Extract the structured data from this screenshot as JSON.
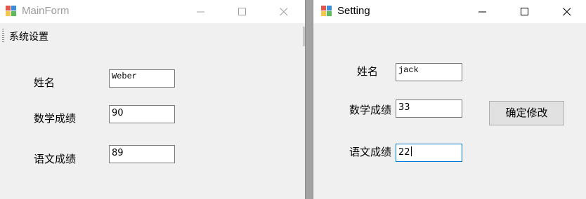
{
  "main_form": {
    "title": "MainForm",
    "menu": {
      "item_label": "系统设置"
    },
    "fields": {
      "name": {
        "label": "姓名",
        "value": "Weber"
      },
      "math": {
        "label": "数学成绩",
        "value": "90"
      },
      "chinese": {
        "label": "语文成绩",
        "value": "89"
      }
    }
  },
  "setting_form": {
    "title": "Setting",
    "fields": {
      "name": {
        "label": "姓名",
        "value": "jack"
      },
      "math": {
        "label": "数学成绩",
        "value": "33"
      },
      "chinese": {
        "label": "语文成绩",
        "value": "22"
      }
    },
    "confirm_button_label": "确定修改"
  },
  "colors": {
    "focus_border": "#0078d7",
    "window_bg": "#f0f0f0",
    "titlebar_bg": "#ffffff"
  },
  "icons": [
    "app-icon",
    "minimize-icon",
    "maximize-icon",
    "close-icon"
  ]
}
